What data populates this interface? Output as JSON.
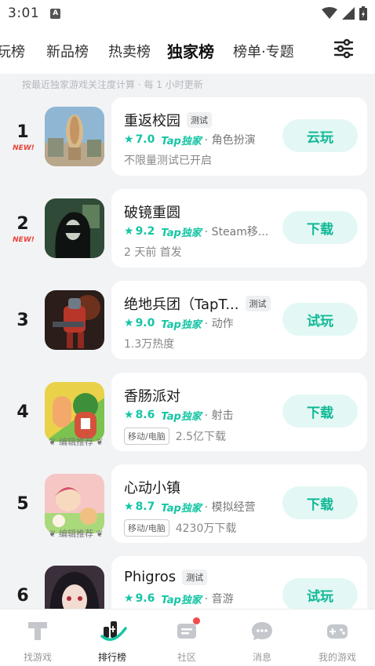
{
  "status_bar": {
    "time": "3:01",
    "notification_glyph": "A"
  },
  "tabs": [
    {
      "label": "玩榜"
    },
    {
      "label": "新品榜"
    },
    {
      "label": "热卖榜"
    },
    {
      "label": "独家榜"
    },
    {
      "label": "榜单·专题"
    }
  ],
  "active_tab_index": 3,
  "caption": "按最近独家游戏关注度计算 · 每 1 小时更新",
  "games": [
    {
      "rank": "1",
      "badge": "NEW!",
      "title": "重返校园",
      "test_tag": "测试",
      "score": "7.0",
      "exclusive": "Tap独家",
      "genre": "· 角色扮演",
      "platform": "",
      "sub": "不限量测试已开启",
      "action": "云玩",
      "editor_pick": ""
    },
    {
      "rank": "2",
      "badge": "NEW!",
      "title": "破镜重圆",
      "test_tag": "",
      "score": "9.2",
      "exclusive": "Tap独家",
      "genre": "· Steam移...",
      "platform": "",
      "sub": "2 天前 首发",
      "action": "下载",
      "editor_pick": ""
    },
    {
      "rank": "3",
      "badge": "",
      "title": "绝地兵团（TapT...",
      "test_tag": "测试",
      "score": "9.0",
      "exclusive": "Tap独家",
      "genre": "· 动作",
      "platform": "",
      "sub": "1.3万热度",
      "action": "试玩",
      "editor_pick": ""
    },
    {
      "rank": "4",
      "badge": "",
      "title": "香肠派对",
      "test_tag": "",
      "score": "8.6",
      "exclusive": "Tap独家",
      "genre": "· 射击",
      "platform": "移动/电脑",
      "sub": "2.5亿下载",
      "action": "下载",
      "editor_pick": "编辑推荐"
    },
    {
      "rank": "5",
      "badge": "",
      "title": "心动小镇",
      "test_tag": "",
      "score": "8.7",
      "exclusive": "Tap独家",
      "genre": "· 模拟经营",
      "platform": "移动/电脑",
      "sub": "4230万下载",
      "action": "下载",
      "editor_pick": "编辑推荐"
    },
    {
      "rank": "6",
      "badge": "",
      "title": "Phigros",
      "test_tag": "测试",
      "score": "9.6",
      "exclusive": "Tap独家",
      "genre": "· 音游",
      "platform": "",
      "sub": "",
      "action": "试玩",
      "editor_pick": ""
    }
  ],
  "bottom_nav": [
    {
      "label": "找游戏"
    },
    {
      "label": "排行榜"
    },
    {
      "label": "社区"
    },
    {
      "label": "消息"
    },
    {
      "label": "我的游戏"
    }
  ],
  "active_nav_index": 1,
  "colors": {
    "accent": "#15c5a4",
    "button_bg": "#e3f8f4",
    "new_badge": "#e8423a",
    "notification_dot": "#f24a4a"
  }
}
